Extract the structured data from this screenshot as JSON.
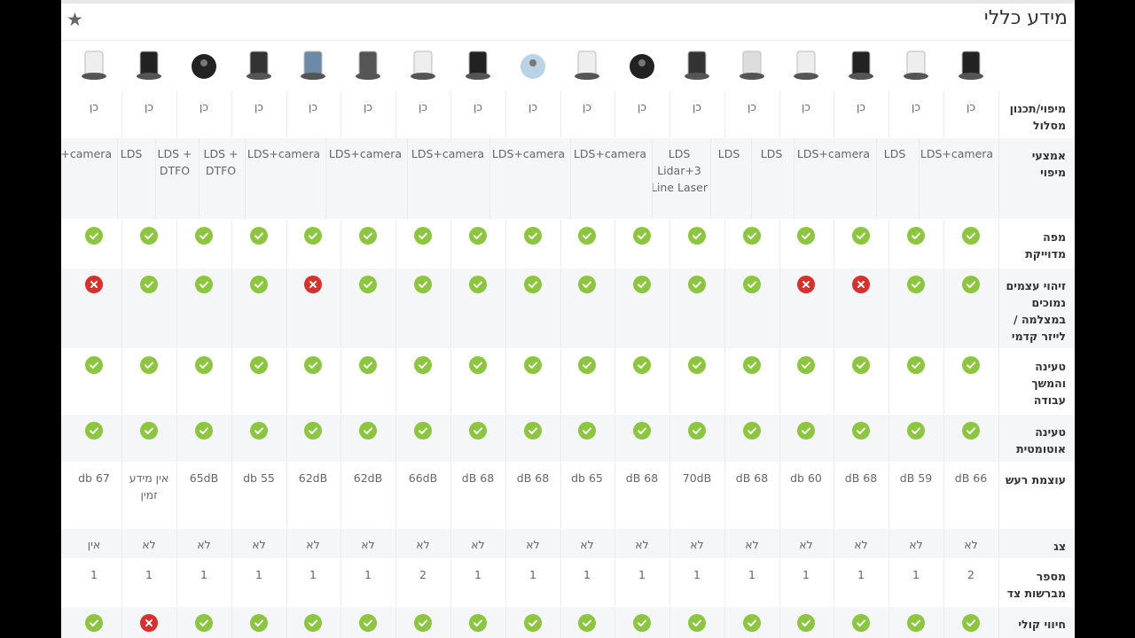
{
  "header": {
    "title": "מידע כללי",
    "star": "★"
  },
  "products": [
    {
      "name": "p1",
      "color": "#222"
    },
    {
      "name": "p2",
      "color": "#eee"
    },
    {
      "name": "p3",
      "color": "#222"
    },
    {
      "name": "p4",
      "color": "#eee"
    },
    {
      "name": "p5",
      "color": "#ddd"
    },
    {
      "name": "p6",
      "color": "#333"
    },
    {
      "name": "p7",
      "color": "#222"
    },
    {
      "name": "p8",
      "color": "#eee"
    },
    {
      "name": "p9",
      "color": "#b9d3e6"
    },
    {
      "name": "p10",
      "color": "#222"
    },
    {
      "name": "p11",
      "color": "#eee"
    },
    {
      "name": "p12",
      "color": "#555"
    },
    {
      "name": "p13",
      "color": "#6b8aa8"
    },
    {
      "name": "p14",
      "color": "#333"
    },
    {
      "name": "p15",
      "color": "#222"
    },
    {
      "name": "p16",
      "color": "#222"
    },
    {
      "name": "p17",
      "color": "#eee"
    }
  ],
  "rows": [
    {
      "label": "מיפוי/תכנון מסלול",
      "type": "text",
      "values": [
        "כן",
        "כן",
        "כן",
        "כן",
        "כן",
        "כן",
        "כן",
        "כן",
        "כן",
        "כן",
        "כן",
        "כן",
        "כן",
        "כן",
        "כן",
        "כן",
        "כן"
      ]
    },
    {
      "label": "אמצעי מיפוי",
      "type": "text",
      "values": [
        "LDS+camera",
        "LDS",
        "LDS+camera",
        "LDS",
        "LDS",
        "LDS Lidar+3 Line Laser",
        "LDS+camera",
        "LDS+camera",
        "LDS+camera",
        "LDS+camera",
        "LDS+camera",
        "LDS + DTFO",
        "LDS + DTFO",
        "LDS",
        "LDS+camera"
      ]
    },
    {
      "label": "מפה מדוייקת",
      "type": "icon",
      "values": [
        "ok",
        "ok",
        "ok",
        "ok",
        "ok",
        "ok",
        "ok",
        "ok",
        "ok",
        "ok",
        "ok",
        "ok",
        "ok",
        "ok",
        "ok",
        "ok",
        "ok"
      ]
    },
    {
      "label": "זיהוי עצמים נמוכים במצלמה / לייזר קדמי",
      "type": "icon",
      "values": [
        "ok",
        "ok",
        "no",
        "no",
        "ok",
        "ok",
        "ok",
        "ok",
        "ok",
        "ok",
        "ok",
        "ok",
        "no",
        "ok",
        "ok",
        "ok",
        "no"
      ]
    },
    {
      "label": "טעינה והמשך עבודה",
      "type": "icon",
      "values": [
        "ok",
        "ok",
        "ok",
        "ok",
        "ok",
        "ok",
        "ok",
        "ok",
        "ok",
        "ok",
        "ok",
        "ok",
        "ok",
        "ok",
        "ok",
        "ok",
        "ok"
      ]
    },
    {
      "label": "טעינה אוטומטית",
      "type": "icon",
      "values": [
        "ok",
        "ok",
        "ok",
        "ok",
        "ok",
        "ok",
        "ok",
        "ok",
        "ok",
        "ok",
        "ok",
        "ok",
        "ok",
        "ok",
        "ok",
        "ok",
        "ok"
      ]
    },
    {
      "label": "עוצמת רעש",
      "type": "text",
      "values": [
        "dB 66",
        "dB 59",
        "dB 68",
        "db 60",
        "dB 68",
        "70dB",
        "dB 68",
        "db 65",
        "dB 68",
        "dB 68",
        "66dB",
        "62dB",
        "62dB",
        "db 55",
        "65dB",
        "אין מידע זמין",
        "db 67"
      ]
    },
    {
      "label": "צג",
      "type": "text",
      "values": [
        "לא",
        "לא",
        "לא",
        "לא",
        "לא",
        "לא",
        "לא",
        "לא",
        "לא",
        "לא",
        "לא",
        "לא",
        "לא",
        "לא",
        "לא",
        "לא",
        "אין"
      ]
    },
    {
      "label": "מספר מברשות צד",
      "type": "text",
      "values": [
        "2",
        "1",
        "1",
        "1",
        "1",
        "1",
        "1",
        "1",
        "1",
        "1",
        "2",
        "1",
        "1",
        "1",
        "1",
        "1",
        "1"
      ]
    },
    {
      "label": "חיווי קולי",
      "type": "icon",
      "values": [
        "ok",
        "ok",
        "ok",
        "ok",
        "ok",
        "ok",
        "ok",
        "ok",
        "ok",
        "ok",
        "ok",
        "ok",
        "ok",
        "ok",
        "ok",
        "no",
        "ok"
      ]
    }
  ]
}
